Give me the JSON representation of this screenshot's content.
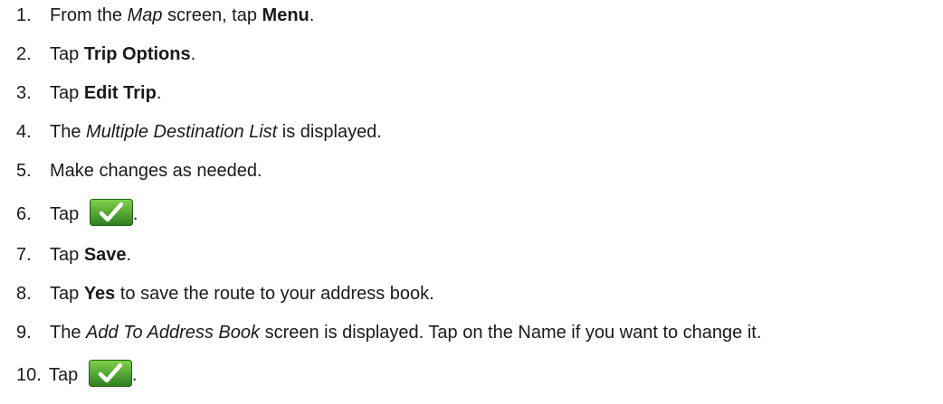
{
  "steps": [
    {
      "num": "1.",
      "parts": [
        "From the ",
        "Map",
        " screen, tap ",
        "Menu",
        "."
      ]
    },
    {
      "num": "2.",
      "parts": [
        "Tap ",
        "Trip Options",
        "."
      ]
    },
    {
      "num": "3.",
      "parts": [
        "Tap ",
        "Edit Trip",
        "."
      ]
    },
    {
      "num": "4.",
      "parts": [
        "The ",
        "Multiple Destination List",
        " is displayed."
      ]
    },
    {
      "num": "5.",
      "parts": [
        "Make changes as needed."
      ]
    },
    {
      "num": "6.",
      "parts": [
        "Tap ",
        "."
      ],
      "icon": "checkmark-button-icon"
    },
    {
      "num": "7.",
      "parts": [
        "Tap ",
        "Save",
        "."
      ]
    },
    {
      "num": "8.",
      "parts": [
        "Tap ",
        "Yes",
        " to save the route to your address book."
      ]
    },
    {
      "num": "9.",
      "parts": [
        "The ",
        "Add To Address Book",
        " screen is displayed.  Tap on the Name if you want to change it."
      ]
    },
    {
      "num": "10.",
      "parts": [
        "Tap ",
        "."
      ],
      "icon": "checkmark-button-icon"
    }
  ],
  "colors": {
    "text": "#1a1a1a",
    "icon_green_dark": "#2e7d1f",
    "icon_green_light": "#7fd34a",
    "icon_check": "#ffffff"
  }
}
